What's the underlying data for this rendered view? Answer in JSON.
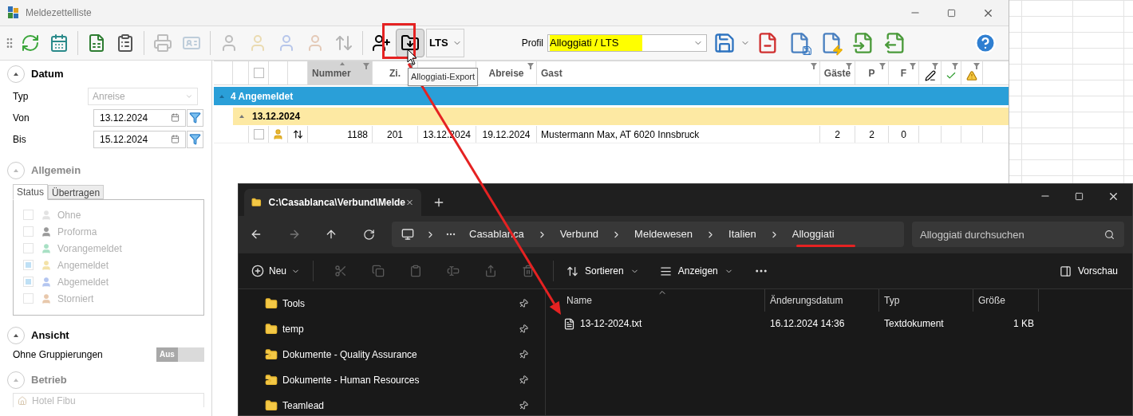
{
  "app_window": {
    "title": "Meldezettelliste",
    "toolbar": {
      "buttons": [
        {
          "disabled": false,
          "pressed": false
        },
        {
          "disabled": false,
          "pressed": false
        },
        {
          "disabled": false,
          "pressed": false
        },
        {
          "disabled": false,
          "pressed": false
        },
        {
          "disabled": true,
          "pressed": false
        },
        {
          "disabled": true,
          "pressed": false
        },
        {
          "disabled": true,
          "pressed": false
        },
        {
          "disabled": true,
          "pressed": false
        },
        {
          "disabled": true,
          "pressed": false
        },
        {
          "disabled": true,
          "pressed": false
        },
        {
          "disabled": true,
          "pressed": false
        },
        {
          "disabled": false,
          "pressed": false
        },
        {
          "disabled": false,
          "pressed": true
        }
      ],
      "split_button": "LTS",
      "profile_label": "Profil",
      "profile_value": "Alloggiati / LTS"
    },
    "tooltip": "Alloggiati-Export",
    "filter_panel": {
      "datum": {
        "title": "Datum",
        "disabled": false,
        "typ": {
          "label": "Typ",
          "value": "Anreise",
          "disabled": true
        },
        "von": {
          "label": "Von",
          "value": "13.12.2024"
        },
        "bis": {
          "label": "Bis",
          "value": "15.12.2024"
        }
      },
      "allgemein": {
        "title": "Allgemein",
        "disabled": true,
        "tabs": [
          {
            "label": "Status",
            "selected": true
          },
          {
            "label": "Übertragen",
            "selected": false
          }
        ],
        "statuses": [
          {
            "label": "Ohne",
            "checked": false,
            "color": "#e2e2e2"
          },
          {
            "label": "Proforma",
            "checked": false,
            "color": "#9a9a9a"
          },
          {
            "label": "Vorangemeldet",
            "checked": false,
            "color": "#a8e0c4"
          },
          {
            "label": "Angemeldet",
            "checked": true,
            "color": "#f3e2a8"
          },
          {
            "label": "Abgemeldet",
            "checked": true,
            "color": "#b4c6f0"
          },
          {
            "label": "Storniert",
            "checked": false,
            "color": "#e8c8ac"
          }
        ]
      },
      "ansicht": {
        "title": "Ansicht",
        "disabled": false,
        "option": "Ohne Gruppierungen",
        "switch": {
          "label": "Aus",
          "on": false
        }
      },
      "betrieb": {
        "title": "Betrieb",
        "disabled": true,
        "field_value": "Hotel Fibu"
      }
    },
    "table": {
      "columns": [
        {
          "kind": "blank"
        },
        {
          "kind": "blank"
        },
        {
          "kind": "checkbox",
          "checked": false
        },
        {
          "kind": "blank"
        },
        {
          "kind": "blank"
        },
        {
          "kind": "text",
          "label": "Nummer",
          "sorted": true
        },
        {
          "kind": "text",
          "label": "Zi.",
          "sorted": false
        },
        {
          "kind": "blank"
        },
        {
          "kind": "text",
          "label": "Abreise",
          "sorted": false
        },
        {
          "kind": "text",
          "label": "Gast",
          "sorted": false
        },
        {
          "kind": "text",
          "label": "Gäste",
          "sorted": false
        },
        {
          "kind": "text",
          "label": "P",
          "sorted": false
        },
        {
          "kind": "text",
          "label": "F",
          "sorted": false
        },
        {
          "kind": "icon"
        },
        {
          "kind": "icon"
        },
        {
          "kind": "icon"
        }
      ],
      "groups": [
        {
          "label": "4 Angemeldet",
          "expanded": true,
          "children": [
            {
              "label": "13.12.2024",
              "expanded": true,
              "rows": [
                {
                  "checked": false,
                  "cells": [
                    "1188",
                    "201",
                    "13.12.2024",
                    "19.12.2024",
                    "Mustermann Max, AT 6020 Innsbruck",
                    "2",
                    "2",
                    "0"
                  ]
                }
              ]
            }
          ]
        }
      ]
    }
  },
  "explorer": {
    "tab_title": "C:\\Casablanca\\Verbund\\Melde",
    "breadcrumb": [
      "Casablanca",
      "Verbund",
      "Meldewesen",
      "Italien",
      "Alloggiati"
    ],
    "search_placeholder": "Alloggiati durchsuchen",
    "commands": {
      "new": "Neu",
      "sort": "Sortieren",
      "view": "Anzeigen",
      "preview": "Vorschau"
    },
    "command_icons": [
      {
        "disabled": true
      },
      {
        "disabled": true
      },
      {
        "disabled": true
      },
      {
        "disabled": true
      },
      {
        "disabled": true
      },
      {
        "disabled": true
      }
    ],
    "nav_items": [
      {
        "label": "Tools",
        "kind": "folder"
      },
      {
        "label": "temp",
        "kind": "folder"
      },
      {
        "label": "Dokumente - Quality Assurance",
        "kind": "shared"
      },
      {
        "label": "Dokumente - Human Resources",
        "kind": "shared"
      },
      {
        "label": "Teamlead",
        "kind": "folder"
      }
    ],
    "file_columns": [
      "Name",
      "Änderungsdatum",
      "Typ",
      "Größe"
    ],
    "files": [
      {
        "name": "13-12-2024.txt",
        "modified": "16.12.2024 14:36",
        "type": "Textdokument",
        "size": "1 KB",
        "selected": false
      }
    ]
  }
}
